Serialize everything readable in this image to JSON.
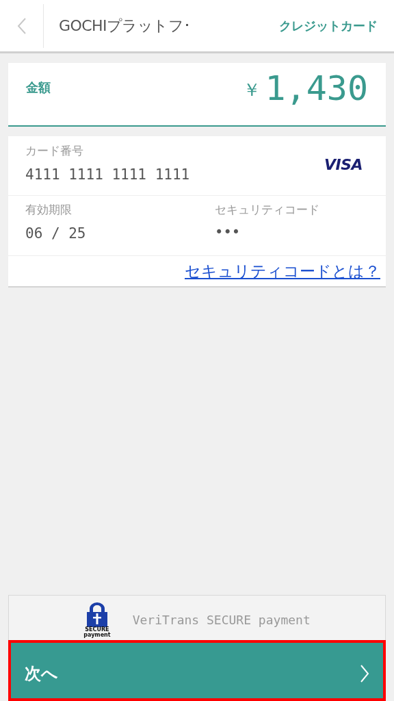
{
  "header": {
    "title": "GOCHIプラットフ･",
    "method": "クレジットカード"
  },
  "amount": {
    "label": "金額",
    "currency": "￥",
    "value": "1,430"
  },
  "card": {
    "number_label": "カード番号",
    "number": "4111 1111 1111 1111",
    "brand": "VISA",
    "expiry_label": "有効期限",
    "expiry": "06 / 25",
    "cvc_label": "セキュリティコード",
    "cvc": "•••",
    "help_link": "セキュリティコードとは？"
  },
  "secure": {
    "logo_top": "SECURE",
    "logo_bottom": "payment",
    "text": "VeriTrans SECURE payment"
  },
  "next_button": {
    "label": "次へ",
    "highlighted": true
  }
}
